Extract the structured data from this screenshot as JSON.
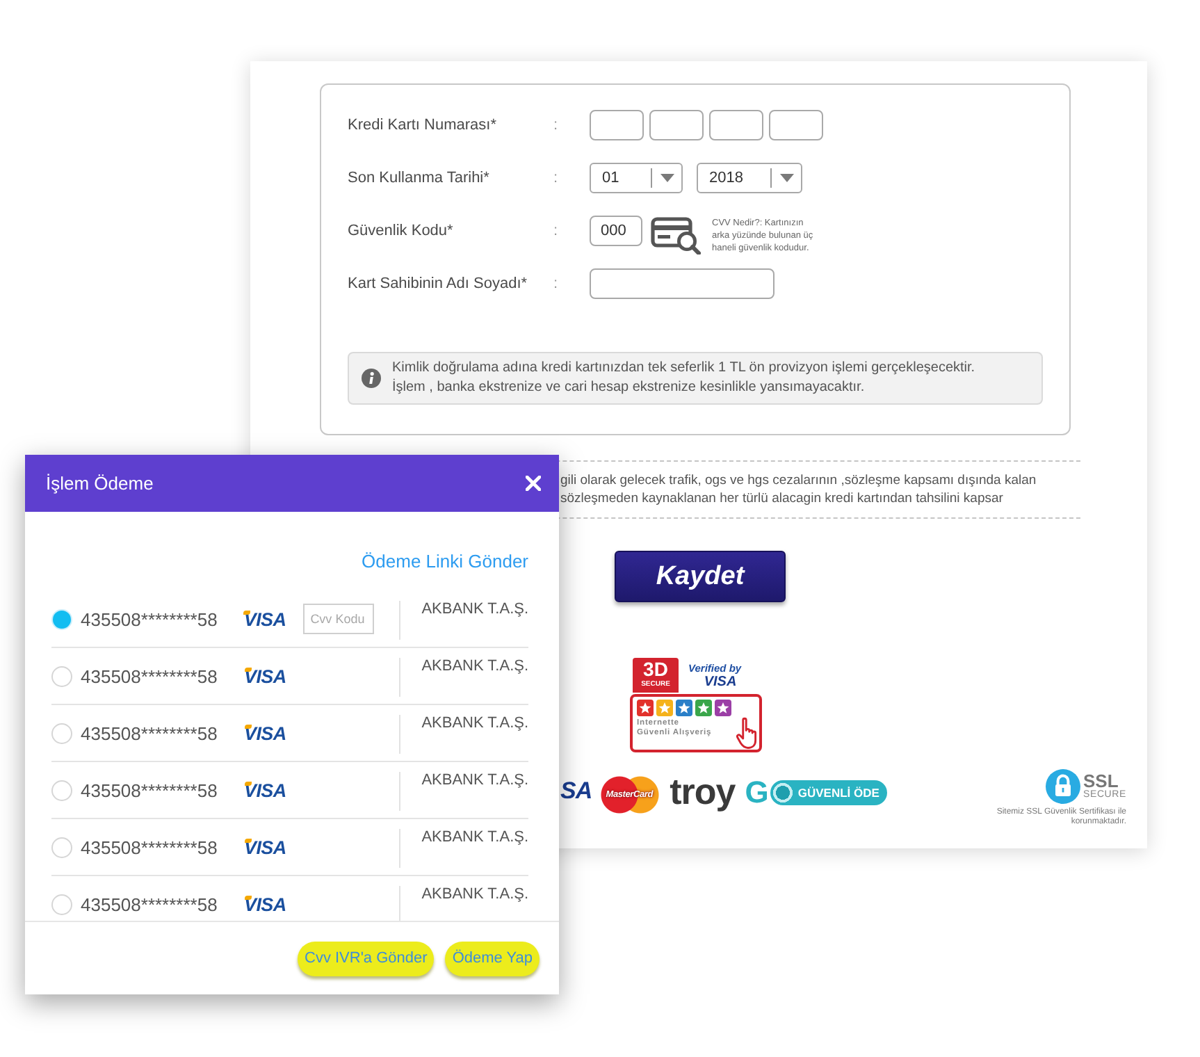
{
  "payment_form": {
    "fields": [
      {
        "kind": "card_number",
        "label": "Kredi Kartı Numarası*",
        "separator": ":"
      },
      {
        "kind": "expiry",
        "label": "Son Kullanma Tarihi*",
        "separator": ":",
        "selects": [
          "01",
          "2018"
        ]
      },
      {
        "kind": "security_code",
        "label": "Güvenlik Kodu*",
        "separator": ":",
        "value": "000",
        "hint_lines": [
          "CVV Nedir?: Kartınızın",
          "arka yüzünde bulunan üç",
          "haneli güvenlik kodudur."
        ]
      },
      {
        "kind": "text",
        "label": "Kart Sahibinin Adı Soyadı*",
        "separator": ":"
      }
    ],
    "notice_lines": [
      "Kimlik doğrulama adına kredi kartınızdan tek seferlik 1 TL ön provizyon işlemi gerçekleşecektir.",
      "İşlem , banka ekstrenize ve cari hesap ekstrenize kesinlikle yansımayacaktır."
    ]
  },
  "terms_lines": [
    "gili olarak gelecek trafik, ogs ve hgs cezalarının ,sözleşme kapsamı dışında kalan",
    "sözleşmeden kaynaklanan her türlü alacagin kredi kartından tahsilini kapsar"
  ],
  "save_button": "Kaydet",
  "secure_badge": {
    "mark": "3D",
    "mark_sub": "SECURE",
    "verified": "Verified by",
    "brand": "VISA",
    "caption_lines": [
      "Internette",
      "Güvenli Alışveriş"
    ]
  },
  "payment_logos": [
    {
      "kind": "visa",
      "text": "SA"
    },
    {
      "kind": "mastercard",
      "text": "MasterCard"
    },
    {
      "kind": "troy",
      "text": "troy"
    },
    {
      "kind": "go",
      "text": "G",
      "label": "GÜVENLİ ÖDE"
    }
  ],
  "ssl_badge": {
    "title": "SSL",
    "subtitle": "SECURE",
    "note_lines": [
      "Sitemiz SSL Güvenlik Sertifikası ile",
      "korunmaktadır."
    ]
  },
  "dialog": {
    "title": "İşlem Ödeme",
    "link": "Ödeme Linki Gönder",
    "cvv_placeholder": "Cvv Kodu",
    "cards": [
      {
        "number": "435508********58",
        "brand": "VISA",
        "bank": "AKBANK T.A.Ş.",
        "selected": true
      },
      {
        "number": "435508********58",
        "brand": "VISA",
        "bank": "AKBANK T.A.Ş.",
        "selected": false
      },
      {
        "number": "435508********58",
        "brand": "VISA",
        "bank": "AKBANK T.A.Ş.",
        "selected": false
      },
      {
        "number": "435508********58",
        "brand": "VISA",
        "bank": "AKBANK T.A.Ş.",
        "selected": false
      },
      {
        "number": "435508********58",
        "brand": "VISA",
        "bank": "AKBANK T.A.Ş.",
        "selected": false
      },
      {
        "number": "435508********58",
        "brand": "VISA",
        "bank": "AKBANK T.A.Ş.",
        "selected": false
      }
    ],
    "buttons": [
      "Cvv IVR'a Gönder",
      "Ödeme Yap"
    ]
  }
}
